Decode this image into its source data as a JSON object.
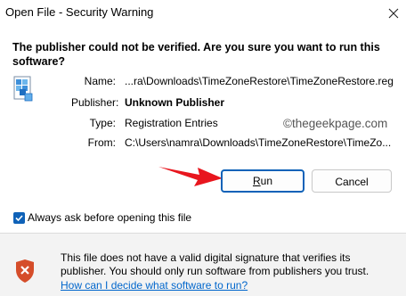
{
  "window": {
    "title": "Open File - Security Warning",
    "close_icon": "close-icon"
  },
  "main": {
    "question": "The publisher could not be verified.  Are you sure you want to run this software?",
    "file_icon": "registry-file-icon",
    "details": {
      "name_label": "Name:",
      "name_value": "...ra\\Downloads\\TimeZoneRestore\\TimeZoneRestore.reg",
      "publisher_label": "Publisher:",
      "publisher_value": "Unknown Publisher",
      "type_label": "Type:",
      "type_value": "Registration Entries",
      "from_label": "From:",
      "from_value": "C:\\Users\\namra\\Downloads\\TimeZoneRestore\\TimeZo..."
    },
    "watermark": "©thegeekpage.com"
  },
  "buttons": {
    "run_label": "Run",
    "cancel_label": "Cancel"
  },
  "checkbox": {
    "label": "Always ask before opening this file",
    "checked": true
  },
  "footer": {
    "shield_icon": "shield-warning-icon",
    "message": "This file does not have a valid digital signature that verifies its publisher.  You should only run software from publishers you trust.",
    "link_text": "How can I decide what software to run?"
  },
  "colors": {
    "accent": "#0f62b8",
    "arrow": "#e8161e",
    "shield": "#d54d2a",
    "footer_bg": "#f3f3f3",
    "link": "#0066cc"
  }
}
